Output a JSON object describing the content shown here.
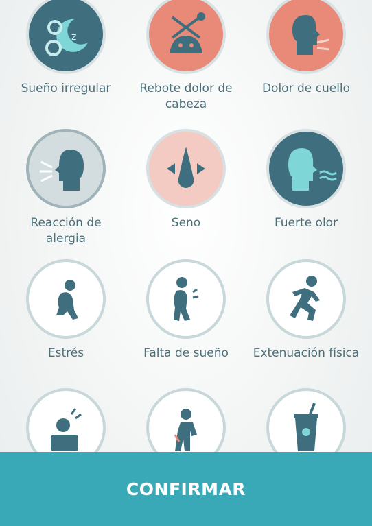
{
  "triggers": [
    {
      "label": "Sueño irregular",
      "icon": "moon-sleep-icon"
    },
    {
      "label": "Rebote dolor de cabeza",
      "icon": "headache-rebound-icon"
    },
    {
      "label": "Dolor de cuello",
      "icon": "neck-pain-icon"
    },
    {
      "label": "Reacción de alergia",
      "icon": "allergy-sneeze-icon"
    },
    {
      "label": "Seno",
      "icon": "sinus-nose-icon"
    },
    {
      "label": "Fuerte olor",
      "icon": "strong-smell-icon"
    },
    {
      "label": "Estrés",
      "icon": "stress-person-icon"
    },
    {
      "label": "Falta de sueño",
      "icon": "tired-person-icon"
    },
    {
      "label": "Extenuación física",
      "icon": "running-person-icon"
    },
    {
      "label": "",
      "icon": "hit-head-icon"
    },
    {
      "label": "",
      "icon": "back-pain-person-icon"
    },
    {
      "label": "",
      "icon": "drink-cup-icon"
    }
  ],
  "confirm_label": "CONFIRMAR",
  "colors": {
    "accent": "#3aa9b7",
    "dark_teal": "#3f6f7e",
    "salmon": "#e98a78",
    "label_text": "#4b6f79"
  }
}
